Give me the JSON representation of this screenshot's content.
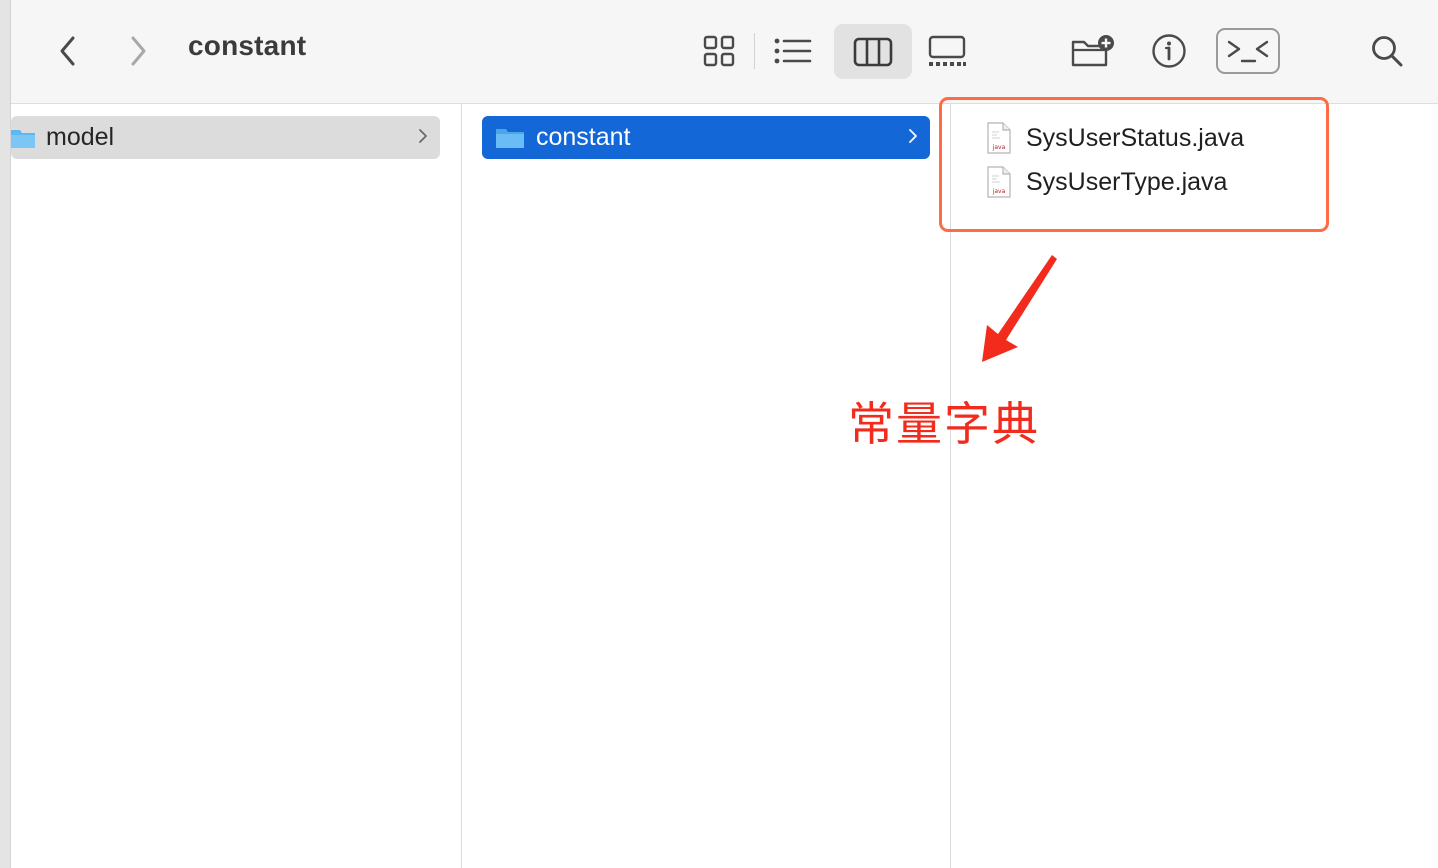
{
  "toolbar": {
    "title": "constant",
    "back_icon": "chevron-left-icon",
    "forward_icon": "chevron-right-icon",
    "views": [
      "icon-view",
      "list-view",
      "column-view",
      "gallery-view"
    ],
    "active_view": "column-view",
    "actions": [
      "new-folder-icon",
      "info-icon",
      "terminal-icon",
      "search-icon"
    ]
  },
  "columns": [
    {
      "items": [
        {
          "label": "model",
          "icon": "folder-icon",
          "selected": "inactive",
          "has_children": true
        }
      ]
    },
    {
      "items": [
        {
          "label": "constant",
          "icon": "folder-icon",
          "selected": "active",
          "has_children": true
        }
      ]
    },
    {
      "items": [
        {
          "label": "SysUserStatus.java",
          "icon": "java-file-icon"
        },
        {
          "label": "SysUserType.java",
          "icon": "java-file-icon"
        }
      ]
    }
  ],
  "file_icon_text": "java",
  "annotation": {
    "text": "常量字典",
    "color": "#f22b1d",
    "box_color": "#ff6b45"
  },
  "colors": {
    "selection_active": "#1467d6",
    "selection_inactive": "#dcdcdc",
    "folder": "#5fb7f0"
  }
}
